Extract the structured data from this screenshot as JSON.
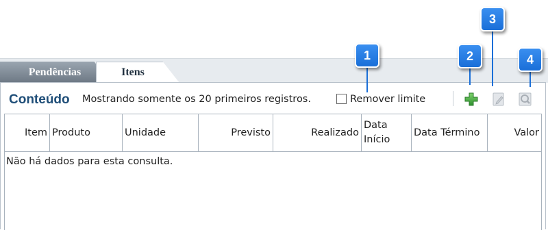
{
  "tabs": [
    {
      "label": "Pendências",
      "active": false
    },
    {
      "label": "Itens",
      "active": true
    }
  ],
  "panel": {
    "title": "Conteúdo",
    "message": "Mostrando somente os 20 primeiros registros.",
    "remove_limit_label": "Remover limite",
    "remove_limit_checked": false
  },
  "toolbar": {
    "add_icon": "add-plus-icon",
    "edit_icon": "edit-icon",
    "view_icon": "view-magnifier-icon"
  },
  "grid": {
    "columns": [
      "Item",
      "Produto",
      "Unidade",
      "Previsto",
      "Realizado",
      "Data Início",
      "Data Término",
      "Valor"
    ],
    "column_lines": [
      [
        "Data",
        "Início"
      ]
    ],
    "empty_message": "Não há dados para esta consulta."
  },
  "callouts": [
    "1",
    "2",
    "3",
    "4"
  ],
  "colors": {
    "accent": "#1a6fd8",
    "title": "#1f4e78",
    "add_green": "#3aa53a"
  }
}
